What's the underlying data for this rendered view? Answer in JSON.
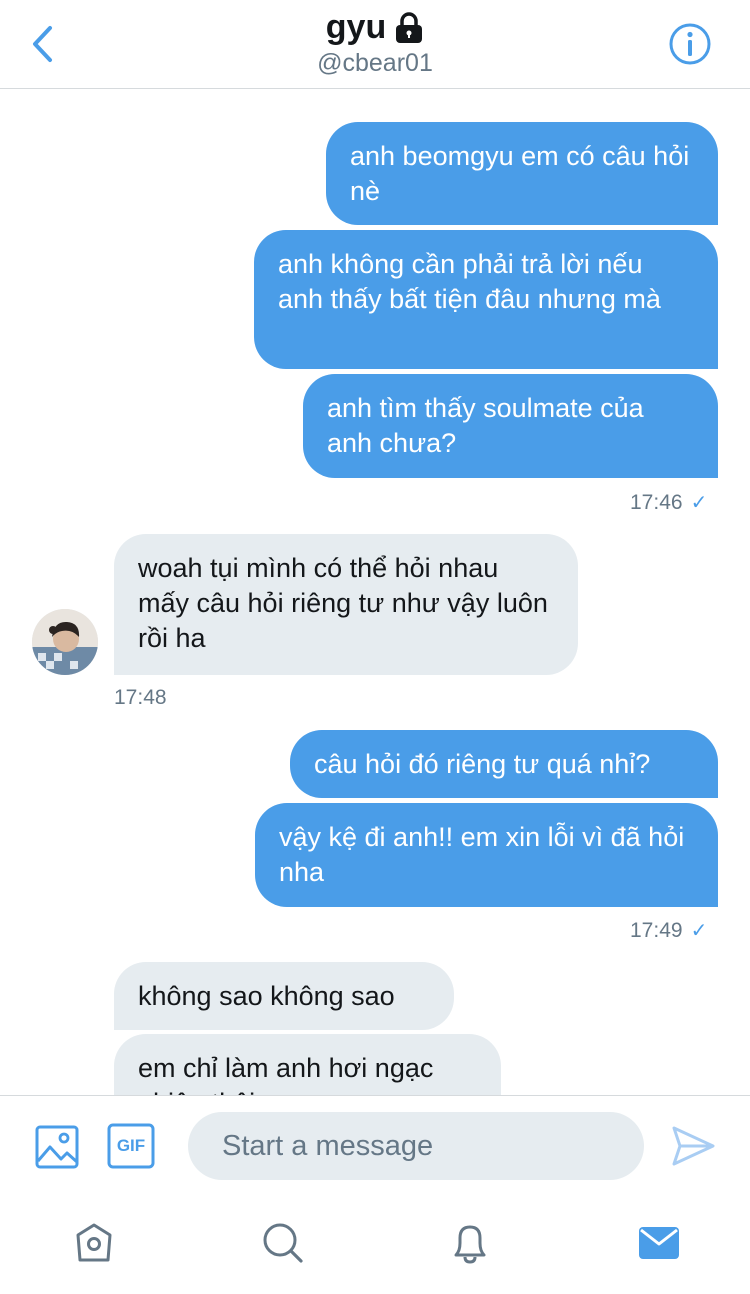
{
  "header": {
    "title": "gyu",
    "handle": "@cbear01",
    "back_icon": "chevron-left-icon",
    "lock_icon": "lock-icon",
    "info_icon": "info-icon"
  },
  "messages": [
    {
      "from": "me",
      "text": "anh beomgyu em có câu hỏi nè"
    },
    {
      "from": "me",
      "text": "anh không cần phải trả lời nếu anh thấy bất tiện đâu nhưng mà"
    },
    {
      "from": "me",
      "text": "anh tìm thấy soulmate của anh chưa?"
    },
    {
      "from": "them",
      "text": "woah tụi mình có thể hỏi nhau mấy câu hỏi riêng tư như vậy luôn rồi ha"
    },
    {
      "from": "me",
      "text": "câu hỏi đó riêng tư quá nhỉ?"
    },
    {
      "from": "me",
      "text": "vậy kệ đi anh!! em xin lỗi vì đã hỏi nha"
    },
    {
      "from": "them",
      "text": "không sao không sao"
    },
    {
      "from": "them",
      "text": "em chỉ làm anh hơi ngạc nhiên thôi"
    }
  ],
  "timestamps": {
    "t1": "17:46",
    "t2": "17:48",
    "t3": "17:49",
    "read_mark": "✓"
  },
  "composer": {
    "placeholder": "Start a message",
    "gif_label": "GIF",
    "image_icon": "image-icon",
    "send_icon": "send-icon"
  },
  "tabbar": {
    "items": [
      "home-icon",
      "search-icon",
      "notifications-icon",
      "messages-icon"
    ],
    "active": "messages-icon"
  },
  "colors": {
    "accent": "#4a9de8",
    "incoming_bubble": "#e6ecf0",
    "secondary_text": "#657786"
  }
}
